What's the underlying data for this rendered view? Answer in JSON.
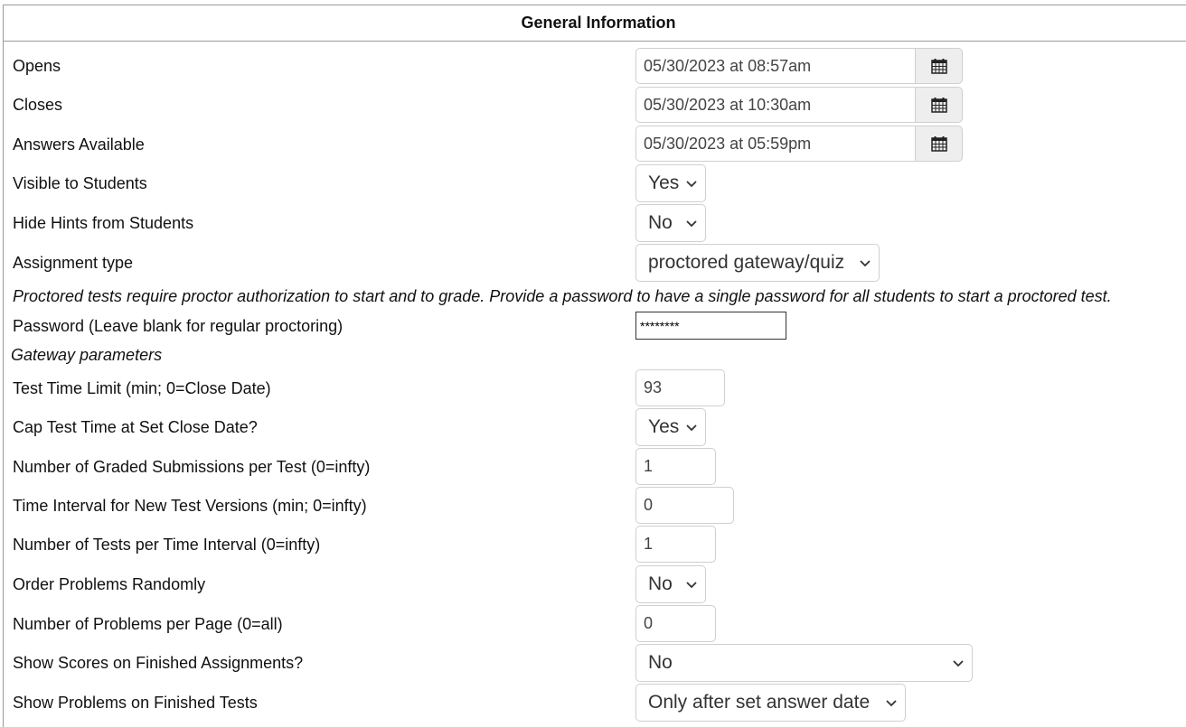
{
  "header": {
    "title": "General Information"
  },
  "dates": {
    "opens": {
      "label": "Opens",
      "value": "05/30/2023 at 08:57am"
    },
    "closes": {
      "label": "Closes",
      "value": "05/30/2023 at 10:30am"
    },
    "answers": {
      "label": "Answers Available",
      "value": "05/30/2023 at 05:59pm"
    }
  },
  "visible": {
    "label": "Visible to Students",
    "value": "Yes"
  },
  "hide_hints": {
    "label": "Hide Hints from Students",
    "value": "No"
  },
  "assignment_type": {
    "label": "Assignment type",
    "value": "proctored gateway/quiz"
  },
  "proctor_note": "Proctored tests require proctor authorization to start and to grade. Provide a password to have a single password for all students to start a proctored test.",
  "password": {
    "label": "Password (Leave blank for regular proctoring)",
    "value": "********"
  },
  "gateway_heading": "Gateway parameters",
  "time_limit": {
    "label": "Test Time Limit (min; 0=Close Date)",
    "value": "93"
  },
  "cap_time": {
    "label": "Cap Test Time at Set Close Date?",
    "value": "Yes"
  },
  "graded_submissions": {
    "label": "Number of Graded Submissions per Test (0=infty)",
    "value": "1"
  },
  "time_interval": {
    "label": "Time Interval for New Test Versions (min; 0=infty)",
    "value": "0"
  },
  "tests_per_interval": {
    "label": "Number of Tests per Time Interval (0=infty)",
    "value": "1"
  },
  "order_random": {
    "label": "Order Problems Randomly",
    "value": "No"
  },
  "problems_per_page": {
    "label": "Number of Problems per Page (0=all)",
    "value": "0"
  },
  "show_scores": {
    "label": "Show Scores on Finished Assignments?",
    "value": "No"
  },
  "show_problems": {
    "label": "Show Problems on Finished Tests",
    "value": "Only after set answer date"
  },
  "icons": {
    "calendar": "calendar-icon",
    "dropdown": "chevron-down-icon"
  }
}
